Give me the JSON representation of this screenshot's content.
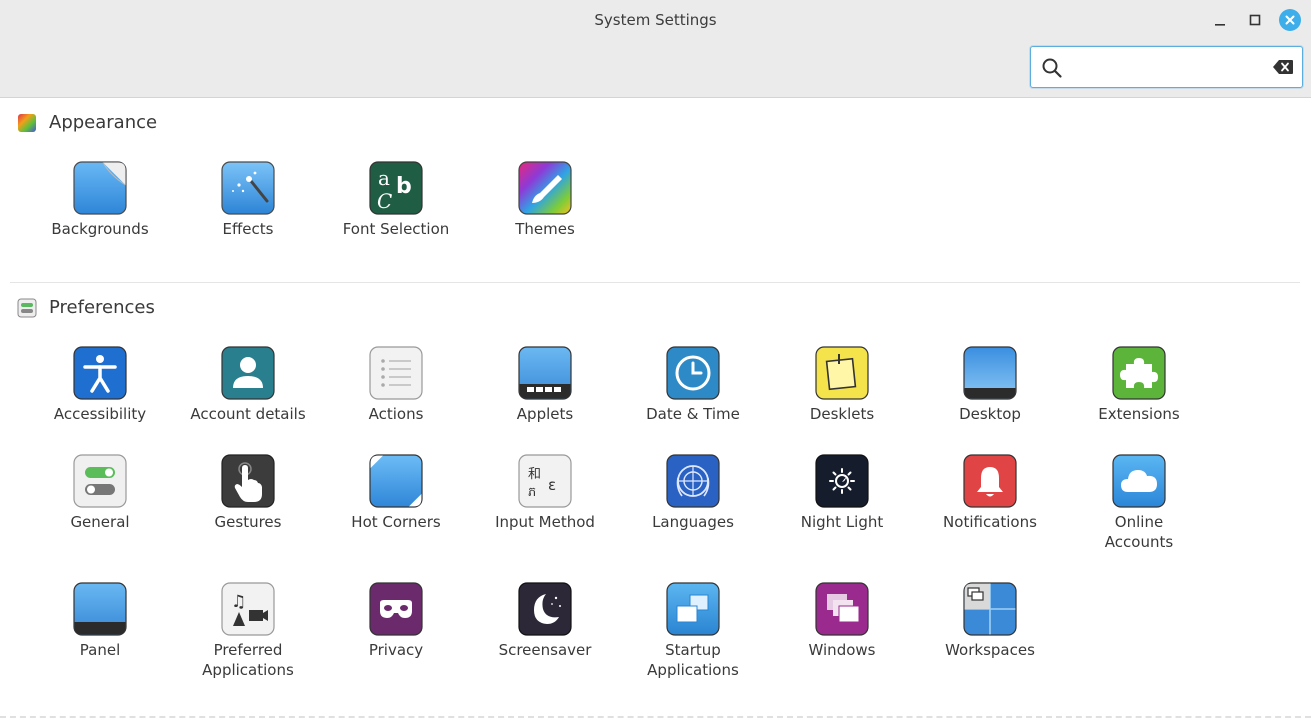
{
  "window": {
    "title": "System Settings"
  },
  "search": {
    "value": "",
    "placeholder": ""
  },
  "sections": {
    "appearance": {
      "title": "Appearance",
      "items": [
        {
          "label": "Backgrounds",
          "icon": "backgrounds-icon"
        },
        {
          "label": "Effects",
          "icon": "effects-icon"
        },
        {
          "label": "Font Selection",
          "icon": "font-selection-icon"
        },
        {
          "label": "Themes",
          "icon": "themes-icon"
        }
      ]
    },
    "preferences": {
      "title": "Preferences",
      "items": [
        {
          "label": "Accessibility",
          "icon": "accessibility-icon"
        },
        {
          "label": "Account details",
          "icon": "account-details-icon"
        },
        {
          "label": "Actions",
          "icon": "actions-icon"
        },
        {
          "label": "Applets",
          "icon": "applets-icon"
        },
        {
          "label": "Date & Time",
          "icon": "clock-icon"
        },
        {
          "label": "Desklets",
          "icon": "desklets-icon"
        },
        {
          "label": "Desktop",
          "icon": "desktop-icon"
        },
        {
          "label": "Extensions",
          "icon": "puzzle-icon"
        },
        {
          "label": "General",
          "icon": "toggles-icon"
        },
        {
          "label": "Gestures",
          "icon": "hand-icon"
        },
        {
          "label": "Hot Corners",
          "icon": "hot-corners-icon"
        },
        {
          "label": "Input Method",
          "icon": "input-method-icon"
        },
        {
          "label": "Languages",
          "icon": "globe-icon"
        },
        {
          "label": "Night Light",
          "icon": "night-light-icon"
        },
        {
          "label": "Notifications",
          "icon": "bell-icon"
        },
        {
          "label": "Online\nAccounts",
          "icon": "cloud-icon"
        },
        {
          "label": "Panel",
          "icon": "panel-icon"
        },
        {
          "label": "Preferred\nApplications",
          "icon": "preferred-apps-icon"
        },
        {
          "label": "Privacy",
          "icon": "mask-icon"
        },
        {
          "label": "Screensaver",
          "icon": "moon-icon"
        },
        {
          "label": "Startup\nApplications",
          "icon": "startup-icon"
        },
        {
          "label": "Windows",
          "icon": "windows-icon"
        },
        {
          "label": "Workspaces",
          "icon": "workspaces-icon"
        }
      ]
    }
  }
}
